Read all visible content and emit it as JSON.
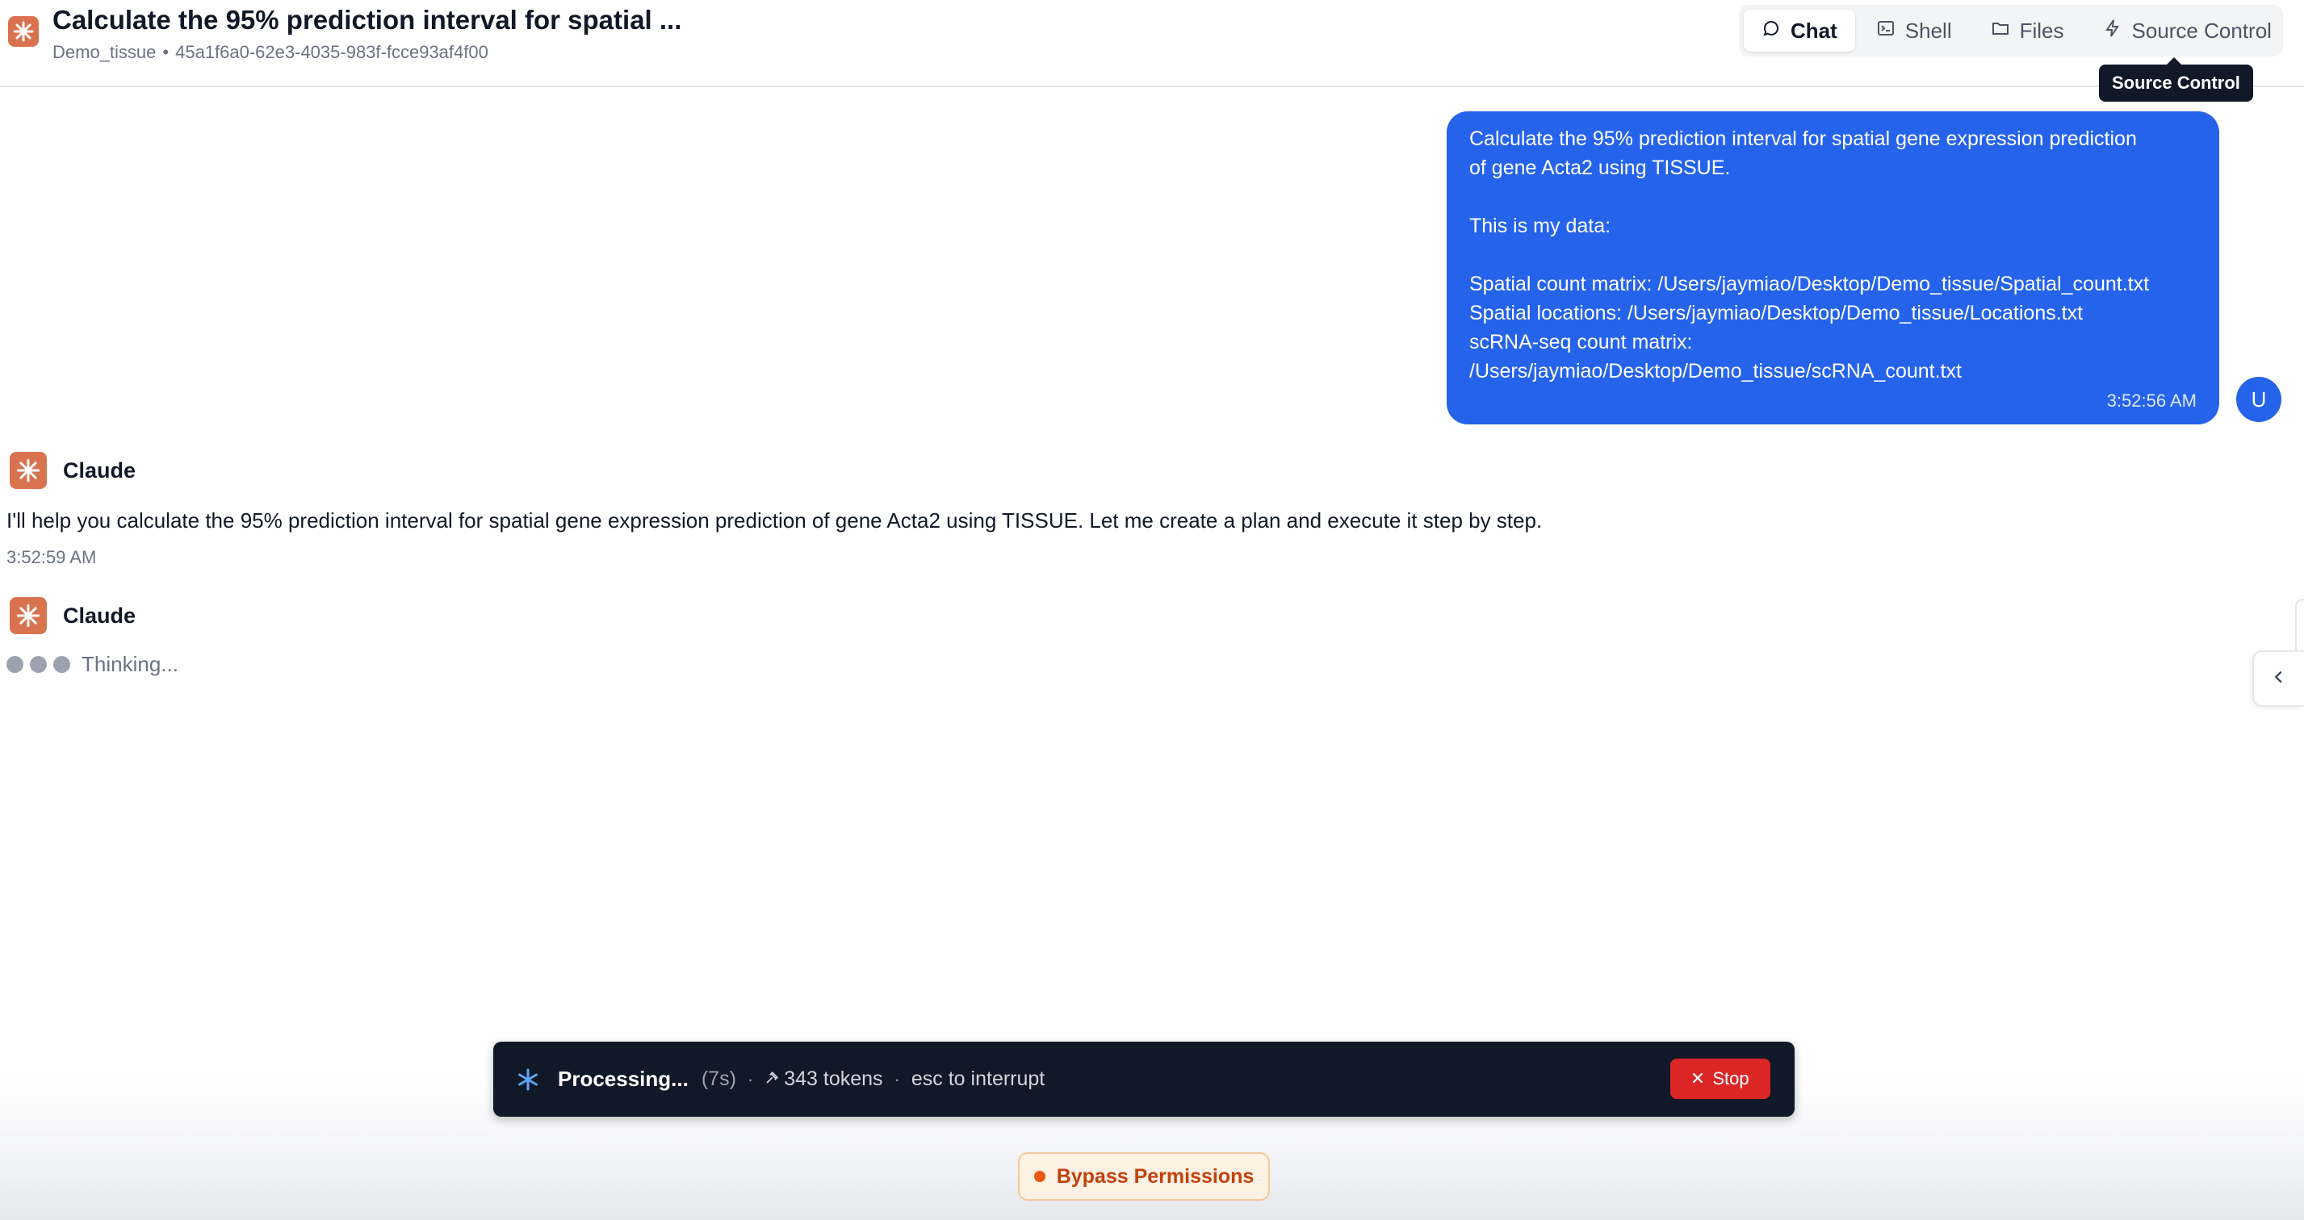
{
  "header": {
    "title": "Calculate the 95% prediction interval for spatial ...",
    "project": "Demo_tissue",
    "separator": "•",
    "session_id": "45a1f6a0-62e3-4035-983f-fcce93af4f00",
    "logo_icon": "claude-spark-icon"
  },
  "tabs": [
    {
      "label": "Chat",
      "icon": "chat-bubble-icon",
      "active": true
    },
    {
      "label": "Shell",
      "icon": "terminal-icon",
      "active": false
    },
    {
      "label": "Files",
      "icon": "folder-icon",
      "active": false
    },
    {
      "label": "Source Control",
      "icon": "lightning-icon",
      "active": false
    }
  ],
  "tooltip": "Source Control",
  "user_message": {
    "text": "Calculate the 95% prediction interval for spatial gene expression prediction\nof gene Acta2 using TISSUE.\n\nThis is my data:\n\nSpatial count matrix: /Users/jaymiao/Desktop/Demo_tissue/Spatial_count.txt\nSpatial locations: /Users/jaymiao/Desktop/Demo_tissue/Locations.txt\nscRNA-seq count matrix:\n/Users/jaymiao/Desktop/Demo_tissue/scRNA_count.txt",
    "time": "3:52:56 AM",
    "avatar": "U",
    "bubble_color": "#2563eb"
  },
  "assistant_messages": [
    {
      "name": "Claude",
      "text": "I'll help you calculate the 95% prediction interval for spatial gene expression prediction of gene Acta2 using TISSUE. Let me create a plan and execute it step by step.",
      "time": "3:52:59 AM"
    },
    {
      "name": "Claude",
      "thinking": "Thinking..."
    }
  ],
  "status_bar": {
    "label": "Processing...",
    "elapsed": "(7s)",
    "sep": "·",
    "tokens": "343 tokens",
    "tokens_icon": "hammer-icon",
    "hint": "esc to interrupt",
    "stop_label": "Stop",
    "stop_color": "#dc2626"
  },
  "permissions": {
    "label": "Bypass Permissions",
    "color": "#ea580c"
  },
  "colors": {
    "accent": "#2563eb",
    "brand": "#d9734f",
    "status_bar_bg": "#111827"
  }
}
